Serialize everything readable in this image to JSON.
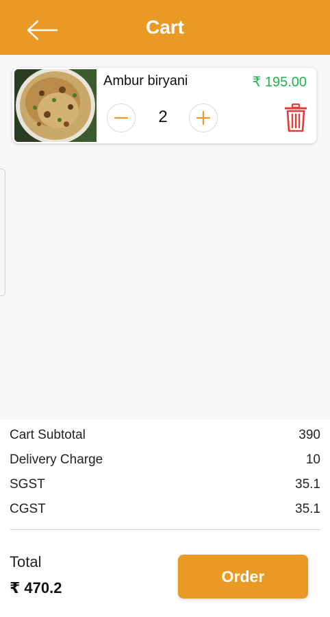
{
  "header": {
    "title": "Cart",
    "back_icon": "arrow-left-icon",
    "background_color": "#e89a25"
  },
  "cart": {
    "items": [
      {
        "name": "Ambur biryani",
        "price": "₹ 195.00",
        "quantity": "2",
        "image": "biryani-plate-image",
        "minus_icon": "minus-icon",
        "plus_icon": "plus-icon",
        "delete_icon": "trash-icon"
      }
    ]
  },
  "summary": {
    "rows": [
      {
        "label": "Cart Subtotal",
        "value": "390"
      },
      {
        "label": "Delivery Charge",
        "value": "10"
      },
      {
        "label": "SGST",
        "value": "35.1"
      },
      {
        "label": "CGST",
        "value": "35.1"
      }
    ],
    "total_label": "Total",
    "total_value": "₹ 470.2",
    "order_label": "Order"
  },
  "colors": {
    "accent": "#e89a25",
    "price_green": "#1fb34a",
    "delete_red": "#e53935"
  }
}
